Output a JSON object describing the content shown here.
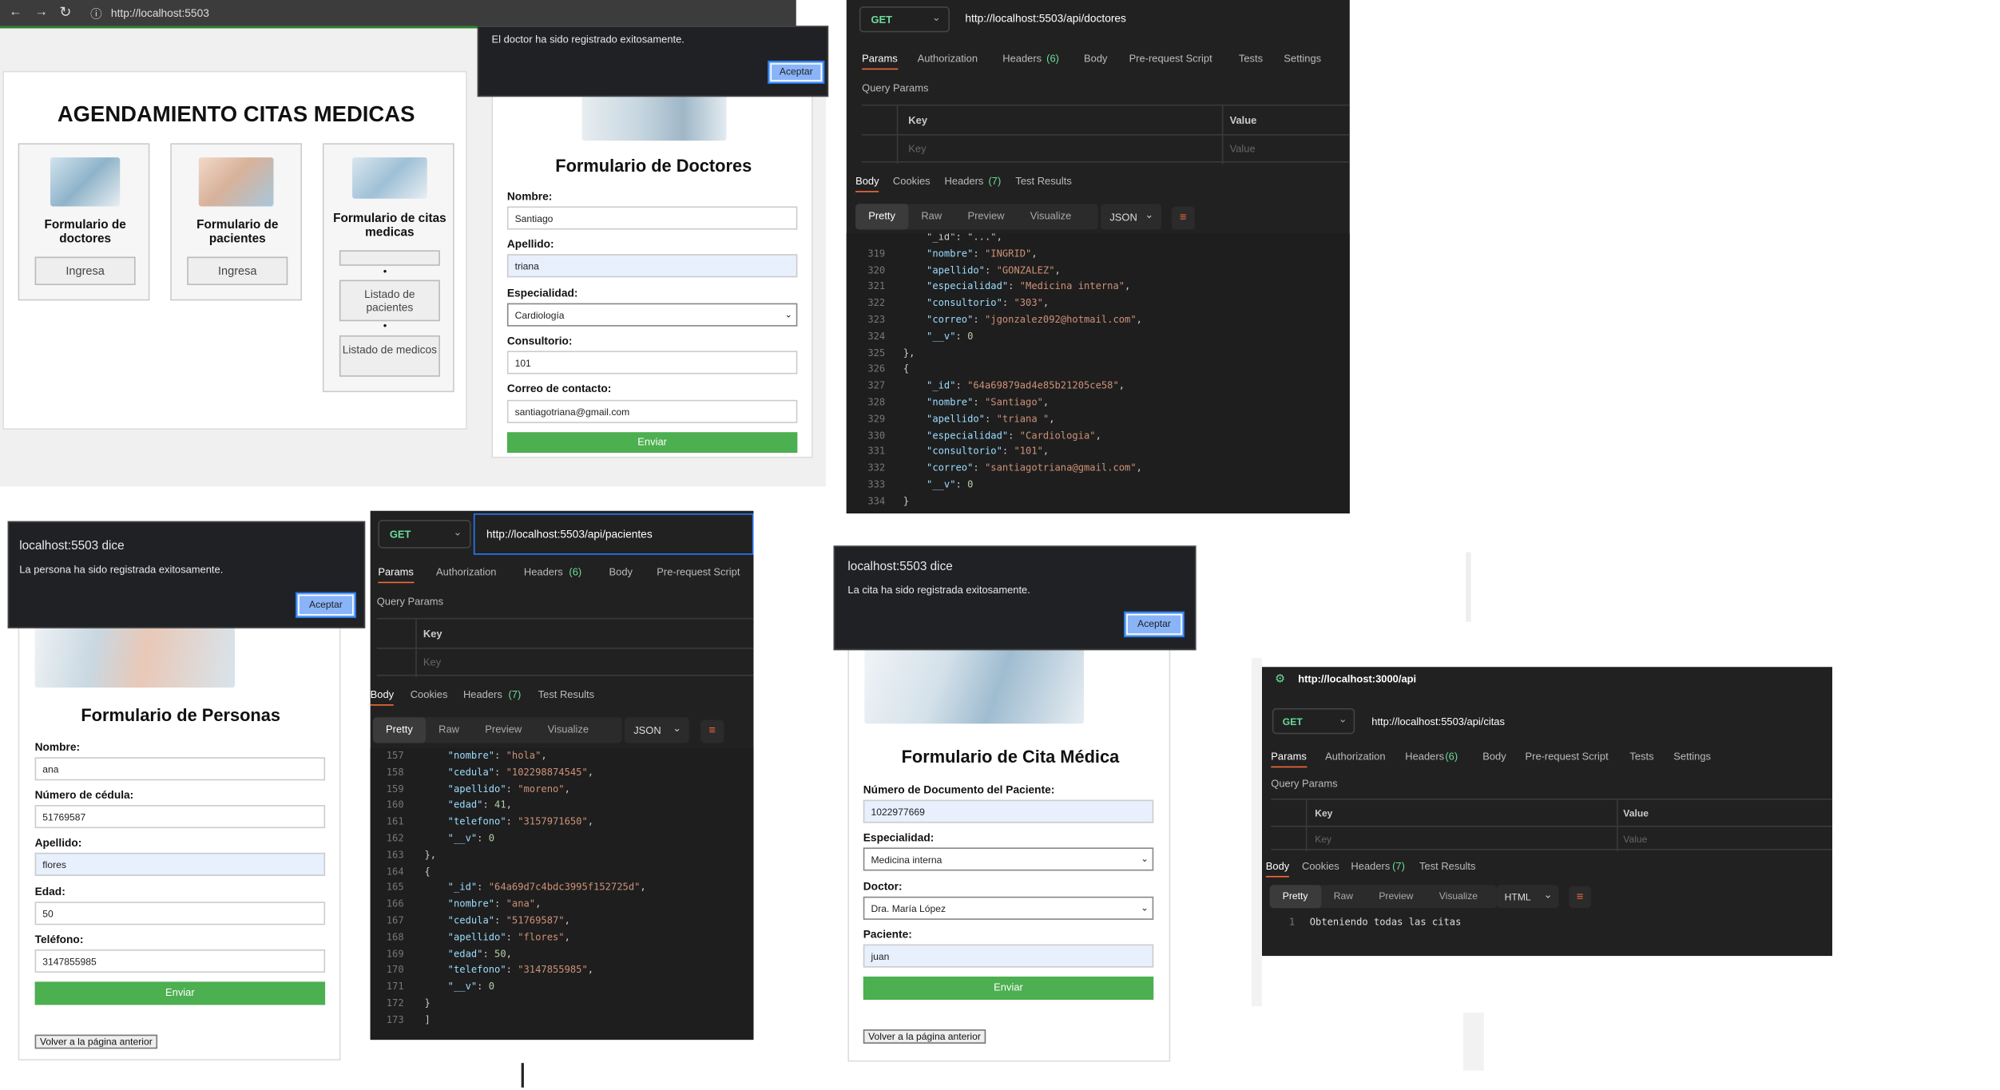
{
  "browser": {
    "url": "http://localhost:5503"
  },
  "home": {
    "title": "AGENDAMIENTO CITAS MEDICAS",
    "cards": [
      {
        "title": "Formulario de doctores",
        "button": "Ingresa"
      },
      {
        "title": "Formulario de pacientes",
        "button": "Ingresa"
      },
      {
        "title": "Formulario de citas medicas",
        "links": [
          "Listado de pacientes",
          "Listado de medicos"
        ]
      }
    ]
  },
  "doctor_alert": {
    "message": "El doctor ha sido registrado exitosamente.",
    "button": "Aceptar"
  },
  "doctor_form": {
    "title": "Formulario de Doctores",
    "fields": [
      {
        "label": "Nombre:",
        "value": "Santiago"
      },
      {
        "label": "Apellido:",
        "value": "triana"
      },
      {
        "label": "Especialidad:",
        "value": "Cardiología"
      },
      {
        "label": "Consultorio:",
        "value": "101"
      },
      {
        "label": "Correo de contacto:",
        "value": "santiagotriana@gmail.com"
      }
    ],
    "submit": "Enviar"
  },
  "postman_common": {
    "method": "GET",
    "tabs": [
      "Params",
      "Authorization",
      "Headers",
      "(6)",
      "Body",
      "Pre-request Script",
      "Tests",
      "Settings"
    ],
    "query_params": "Query Params",
    "key": "Key",
    "value": "Value",
    "resp_tabs": [
      "Body",
      "Cookies",
      "Headers",
      "(7)",
      "Test Results"
    ],
    "views": [
      "Pretty",
      "Raw",
      "Preview",
      "Visualize"
    ]
  },
  "postman_doctores": {
    "url": "http://localhost:5503/api/doctores",
    "format": "JSON"
  },
  "person_alert": {
    "title": "localhost:5503 dice",
    "message": "La persona ha sido registrada exitosamente.",
    "button": "Aceptar"
  },
  "person_form": {
    "title": "Formulario de Personas",
    "fields": [
      {
        "label": "Nombre:",
        "value": "ana"
      },
      {
        "label": "Número de cédula:",
        "value": "51769587"
      },
      {
        "label": "Apellido:",
        "value": "flores"
      },
      {
        "label": "Edad:",
        "value": "50"
      },
      {
        "label": "Teléfono:",
        "value": "3147855985"
      }
    ],
    "submit": "Enviar",
    "back": "Volver a la página anterior"
  },
  "postman_pacientes": {
    "url": "http://localhost:5503/api/pacientes",
    "format": "JSON"
  },
  "cita_alert": {
    "title": "localhost:5503 dice",
    "message": "La cita ha sido registrada exitosamente.",
    "button": "Aceptar"
  },
  "cita_form": {
    "title": "Formulario de Cita Médica",
    "fields": [
      {
        "label": "Número de Documento del Paciente:",
        "value": "1022977669"
      },
      {
        "label": "Especialidad:",
        "value": "Medicina interna"
      },
      {
        "label": "Doctor:",
        "value": "Dra. María López"
      },
      {
        "label": "Paciente:",
        "value": "juan"
      }
    ],
    "submit": "Enviar",
    "back": "Volver a la página anterior"
  },
  "postman_citas": {
    "header": "http://localhost:3000/api",
    "url": "http://localhost:5503/api/citas",
    "format": "HTML",
    "line_no": "1",
    "body": "Obteniendo todas las citas"
  },
  "colors": {
    "accent_green": "#4caf50",
    "postman_orange": "#f26b3a",
    "postman_bg": "#212121"
  }
}
